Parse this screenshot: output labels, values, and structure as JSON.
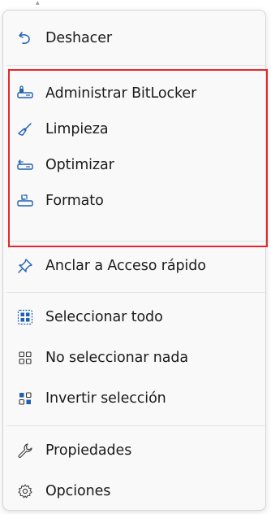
{
  "menu": {
    "items": [
      {
        "id": "deshacer",
        "label": "Deshacer",
        "icon": "undo-icon"
      },
      {
        "id": "bitlocker",
        "label": "Administrar BitLocker",
        "icon": "bitlocker-icon"
      },
      {
        "id": "limpieza",
        "label": "Limpieza",
        "icon": "broom-icon"
      },
      {
        "id": "optimizar",
        "label": "Optimizar",
        "icon": "optimize-icon"
      },
      {
        "id": "formato",
        "label": "Formato",
        "icon": "format-icon"
      },
      {
        "id": "anclar",
        "label": "Anclar a Acceso rápido",
        "icon": "pin-icon"
      },
      {
        "id": "seleccionar",
        "label": "Seleccionar todo",
        "icon": "select-all-icon"
      },
      {
        "id": "no-seleccionar",
        "label": "No seleccionar nada",
        "icon": "select-none-icon"
      },
      {
        "id": "invertir",
        "label": "Invertir selección",
        "icon": "invert-selection-icon"
      },
      {
        "id": "propiedades",
        "label": "Propiedades",
        "icon": "wrench-icon"
      },
      {
        "id": "opciones",
        "label": "Opciones",
        "icon": "gear-icon"
      }
    ]
  },
  "colors": {
    "icon_blue": "#1f5fb4",
    "text": "#1b1b1b",
    "highlight_border": "#e8262a"
  }
}
